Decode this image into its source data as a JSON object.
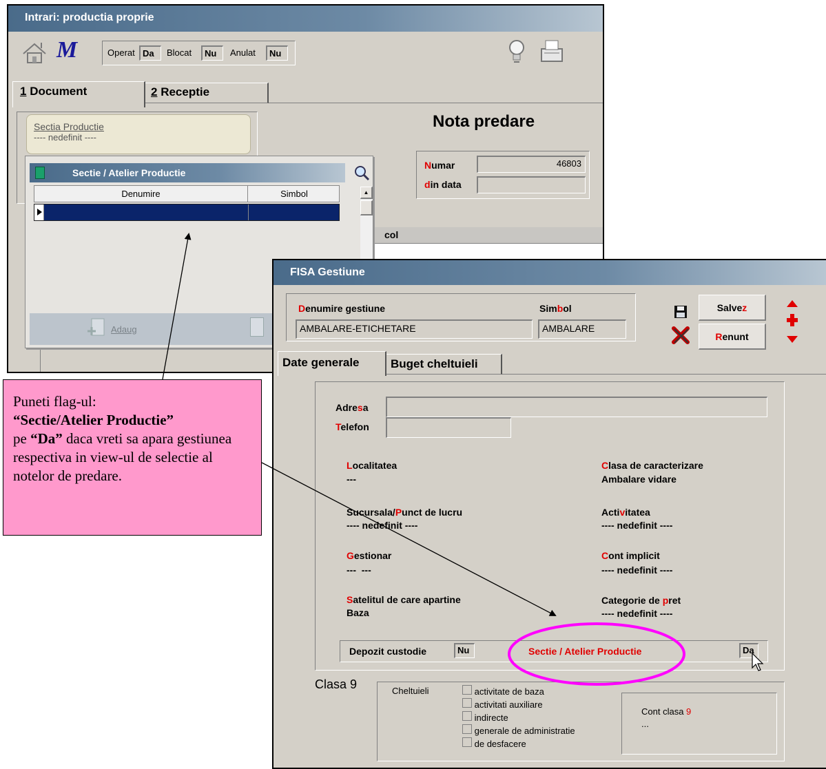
{
  "main_window": {
    "title": "Intrari: productia proprie",
    "toolbar": {
      "operat_label": "Operat",
      "operat_value": "Da",
      "blocat_label": "Blocat",
      "blocat_value": "Nu",
      "anulat_label": "Anulat",
      "anulat_value": "Nu",
      "icons": [
        "house-icon",
        "m-logo-icon",
        "lightbulb-icon",
        "printer-icon"
      ]
    },
    "tabs": [
      {
        "num": "1",
        "label": " Document"
      },
      {
        "num": "2",
        "label": " Receptie"
      }
    ],
    "sectia": {
      "label": "Sectia Productie",
      "value": "---- nedefinit ----"
    },
    "doc_title": "Nota predare",
    "numar": {
      "label_first": "N",
      "label_rest": "umar",
      "value": "46803"
    },
    "din_data": {
      "label_first": "d",
      "label_rest": "in data",
      "value": ""
    },
    "grid_col_fragment": "col"
  },
  "lookup": {
    "title": "Sectie / Atelier Productie",
    "columns": [
      "Denumire",
      "Simbol"
    ],
    "add_label": "Adaug"
  },
  "fisa": {
    "title": "FISA Gestiune",
    "denumire_label": {
      "first": "D",
      "rest": "enumire gestiune"
    },
    "denumire_value": "AMBALARE-ETICHETARE",
    "simbol_label": {
      "a": "Sim",
      "b": "b",
      "c": "ol"
    },
    "simbol_value": "AMBALARE",
    "save_label": {
      "a": "Salve",
      "b": "z"
    },
    "cancel_label": {
      "a": "R",
      "b": "enunt"
    },
    "tabs": [
      "Date generale",
      "Buget cheltuieli"
    ],
    "adresa": {
      "a": "Adre",
      "b": "s",
      "c": "a",
      "value": ""
    },
    "telefon": {
      "a": "T",
      "b": "elefon",
      "value": ""
    },
    "localitatea": {
      "a": "L",
      "b": "ocalitatea",
      "value": "---"
    },
    "clasa": {
      "a": "C",
      "b": "lasa de caracterizare",
      "value": "Ambalare vidare"
    },
    "sucursala": {
      "a": "Sucursala/",
      "b": "P",
      "c": "unct de lucru",
      "value": "---- nedefinit ----"
    },
    "activitatea": {
      "a": "Acti",
      "b": "v",
      "c": "itatea",
      "value": "---- nedefinit ----"
    },
    "gestionar": {
      "a": "G",
      "b": "estionar",
      "value": "---  ---"
    },
    "cont_implicit": {
      "a": "C",
      "b": "o",
      "c": "nt implicit",
      "value": "---- nedefinit ----"
    },
    "satelitul": {
      "a": "S",
      "b": "atelitul de care apartine",
      "value": "Baza"
    },
    "categorie": {
      "a": "Categorie de ",
      "b": "p",
      "c": "ret",
      "value": "---- nedefinit ----"
    },
    "depozit": {
      "label": "Depozit custodie",
      "value": "Nu"
    },
    "sectie_atelier": {
      "label": "Sectie / Atelier Productie",
      "value": "Da"
    },
    "clasa9": {
      "title": "Clasa 9",
      "cheltuieli_label": "Cheltuieli",
      "options": [
        "activitate de baza",
        "activitati auxiliare",
        "indirecte",
        "generale de administratie",
        "de desfacere"
      ],
      "cont_label": "Cont clasa ",
      "cont_digit": "9",
      "cont_value": "..."
    }
  },
  "callout": {
    "line1": "Puneti flag-ul:",
    "bold1": "“Sectie/Atelier Productie”",
    "pre2": "pe ",
    "bold2": "“Da”",
    "post2": " daca vreti sa apara gestiunea respectiva in view-ul de selectie al notelor de predare."
  },
  "colors": {
    "callout_bg": "#ff99cc",
    "highlight": "#ff00ff",
    "accent_red": "#e00000",
    "grid_selected": "#0a246a"
  }
}
